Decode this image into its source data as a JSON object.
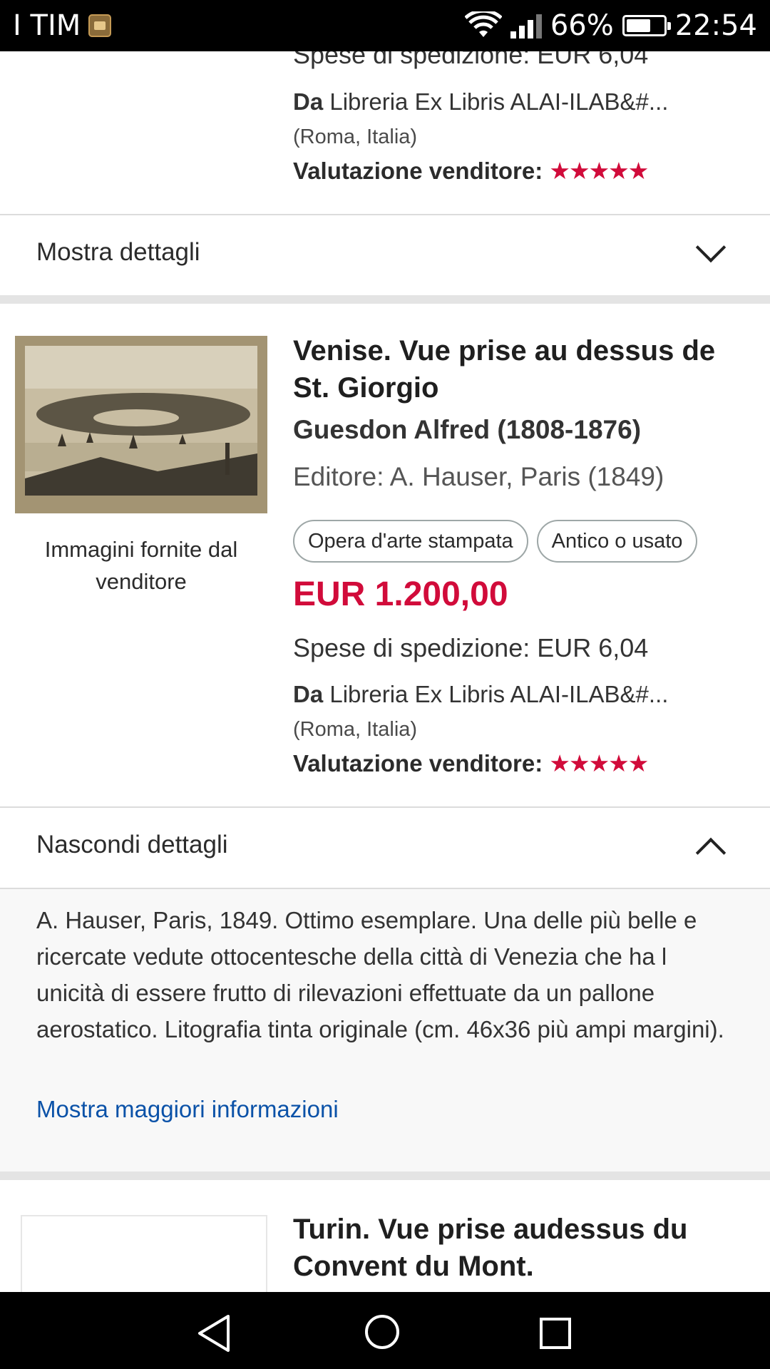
{
  "status_bar": {
    "carrier": "I TIM",
    "battery_percent": "66%",
    "battery_level": 0.66,
    "time": "22:54"
  },
  "prev_listing": {
    "shipping_partial": "Spese di spedizione: EUR 6,04",
    "seller_prefix": "Da",
    "seller_name": "Libreria Ex Libris ALAI-ILAB&#...",
    "seller_location": "(Roma, Italia)",
    "rating_label": "Valutazione venditore:",
    "rating_stars": "★★★★★",
    "rating_value": 5,
    "details_toggle": "Mostra dettagli"
  },
  "listing": {
    "image_caption": "Immagini fornite dal venditore",
    "title": "Venise. Vue prise au dessus de St. Giorgio",
    "author": "Guesdon Alfred (1808-1876)",
    "publisher": "Editore: A. Hauser, Paris (1849)",
    "badges": [
      "Opera d'arte stampata",
      "Antico o usato"
    ],
    "price": "EUR 1.200,00",
    "shipping": "Spese di spedizione: EUR 6,04",
    "seller_prefix": "Da",
    "seller_name": "Libreria Ex Libris ALAI-ILAB&#...",
    "seller_location": "(Roma, Italia)",
    "rating_label": "Valutazione venditore:",
    "rating_stars": "★★★★★",
    "rating_value": 5,
    "details_toggle": "Nascondi dettagli",
    "description": "A. Hauser, Paris, 1849. Ottimo esemplare. Una delle più belle e ricercate vedute ottocentesche della città di Venezia che ha l unicità di essere frutto di rilevazioni effettuate da un pallone aerostatico. Litografia tinta originale (cm. 46x36 più ampi margini).",
    "more_info_link": "Mostra maggiori informazioni"
  },
  "next_listing": {
    "title": "Turin. Vue prise audessus du Convent du Mont."
  },
  "colors": {
    "accent_price": "#d10b3a",
    "link": "#0b52a8",
    "separator": "#e4e4e4"
  }
}
